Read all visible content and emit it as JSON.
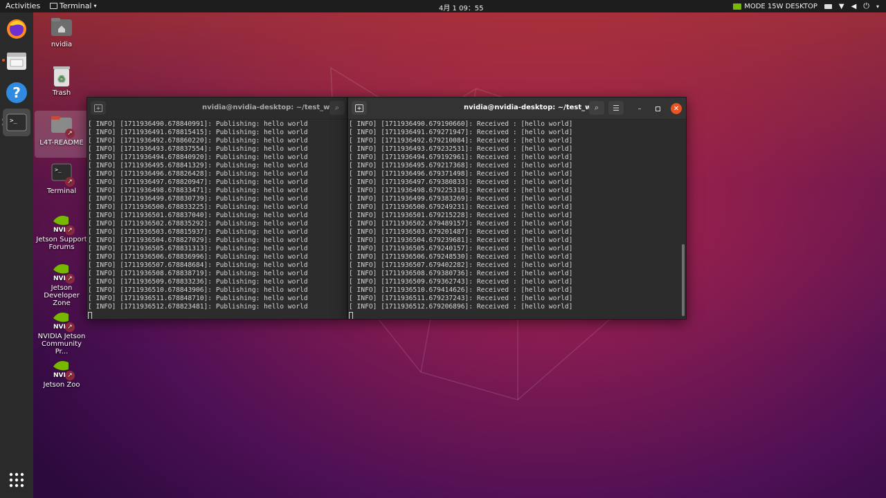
{
  "topbar": {
    "activities": "Activities",
    "app_menu": "Terminal",
    "clock": "4月 1 09：55",
    "mode": "MODE 15W DESKTOP"
  },
  "dock": {
    "items": [
      "firefox-icon",
      "files-icon",
      "help-icon",
      "terminal-icon"
    ],
    "show_apps": "apps-grid-icon"
  },
  "desktop": {
    "icons": [
      {
        "label": "nvidia"
      },
      {
        "label": "Trash"
      },
      {
        "label": "L4T-README"
      },
      {
        "label": "Terminal"
      },
      {
        "label": "Jetson Support Forums"
      },
      {
        "label": "Jetson Developer Zone"
      },
      {
        "label": "NVIDIA Jetson Community Pr..."
      },
      {
        "label": "Jetson Zoo"
      }
    ]
  },
  "terminal_left": {
    "title": "nvidia@nvidia-desktop: ~/test_ws",
    "lines": [
      "[ INFO] [1711936490.678840991]: Publishing: hello world",
      "[ INFO] [1711936491.678815415]: Publishing: hello world",
      "[ INFO] [1711936492.678860220]: Publishing: hello world",
      "[ INFO] [1711936493.678837554]: Publishing: hello world",
      "[ INFO] [1711936494.678840920]: Publishing: hello world",
      "[ INFO] [1711936495.678841329]: Publishing: hello world",
      "[ INFO] [1711936496.678826428]: Publishing: hello world",
      "[ INFO] [1711936497.678820947]: Publishing: hello world",
      "[ INFO] [1711936498.678833471]: Publishing: hello world",
      "[ INFO] [1711936499.678830739]: Publishing: hello world",
      "[ INFO] [1711936500.678833225]: Publishing: hello world",
      "[ INFO] [1711936501.678837040]: Publishing: hello world",
      "[ INFO] [1711936502.678835292]: Publishing: hello world",
      "[ INFO] [1711936503.678815937]: Publishing: hello world",
      "[ INFO] [1711936504.678827029]: Publishing: hello world",
      "[ INFO] [1711936505.678831313]: Publishing: hello world",
      "[ INFO] [1711936506.678836996]: Publishing: hello world",
      "[ INFO] [1711936507.678848684]: Publishing: hello world",
      "[ INFO] [1711936508.678838719]: Publishing: hello world",
      "[ INFO] [1711936509.678833236]: Publishing: hello world",
      "[ INFO] [1711936510.678843906]: Publishing: hello world",
      "[ INFO] [1711936511.678848710]: Publishing: hello world",
      "[ INFO] [1711936512.678823481]: Publishing: hello world"
    ]
  },
  "terminal_right": {
    "title": "nvidia@nvidia-desktop: ~/test_ws",
    "lines": [
      "[ INFO] [1711936490.679190660]: Received : [hello world]",
      "[ INFO] [1711936491.679271947]: Received : [hello world]",
      "[ INFO] [1711936492.679210084]: Received : [hello world]",
      "[ INFO] [1711936493.679232531]: Received : [hello world]",
      "[ INFO] [1711936494.679192961]: Received : [hello world]",
      "[ INFO] [1711936495.679217368]: Received : [hello world]",
      "[ INFO] [1711936496.679371498]: Received : [hello world]",
      "[ INFO] [1711936497.679380833]: Received : [hello world]",
      "[ INFO] [1711936498.679225318]: Received : [hello world]",
      "[ INFO] [1711936499.679383269]: Received : [hello world]",
      "[ INFO] [1711936500.679249231]: Received : [hello world]",
      "[ INFO] [1711936501.679215228]: Received : [hello world]",
      "[ INFO] [1711936502.679489157]: Received : [hello world]",
      "[ INFO] [1711936503.679201487]: Received : [hello world]",
      "[ INFO] [1711936504.679239681]: Received : [hello world]",
      "[ INFO] [1711936505.679240157]: Received : [hello world]",
      "[ INFO] [1711936506.679248530]: Received : [hello world]",
      "[ INFO] [1711936507.679402282]: Received : [hello world]",
      "[ INFO] [1711936508.679380736]: Received : [hello world]",
      "[ INFO] [1711936509.679362743]: Received : [hello world]",
      "[ INFO] [1711936510.679414626]: Received : [hello world]",
      "[ INFO] [1711936511.679237243]: Received : [hello world]",
      "[ INFO] [1711936512.679206896]: Received : [hello world]"
    ]
  },
  "colors": {
    "accent": "#e95420",
    "terminal_bg": "#2c2c2c",
    "nvidia_green": "#76b900"
  }
}
